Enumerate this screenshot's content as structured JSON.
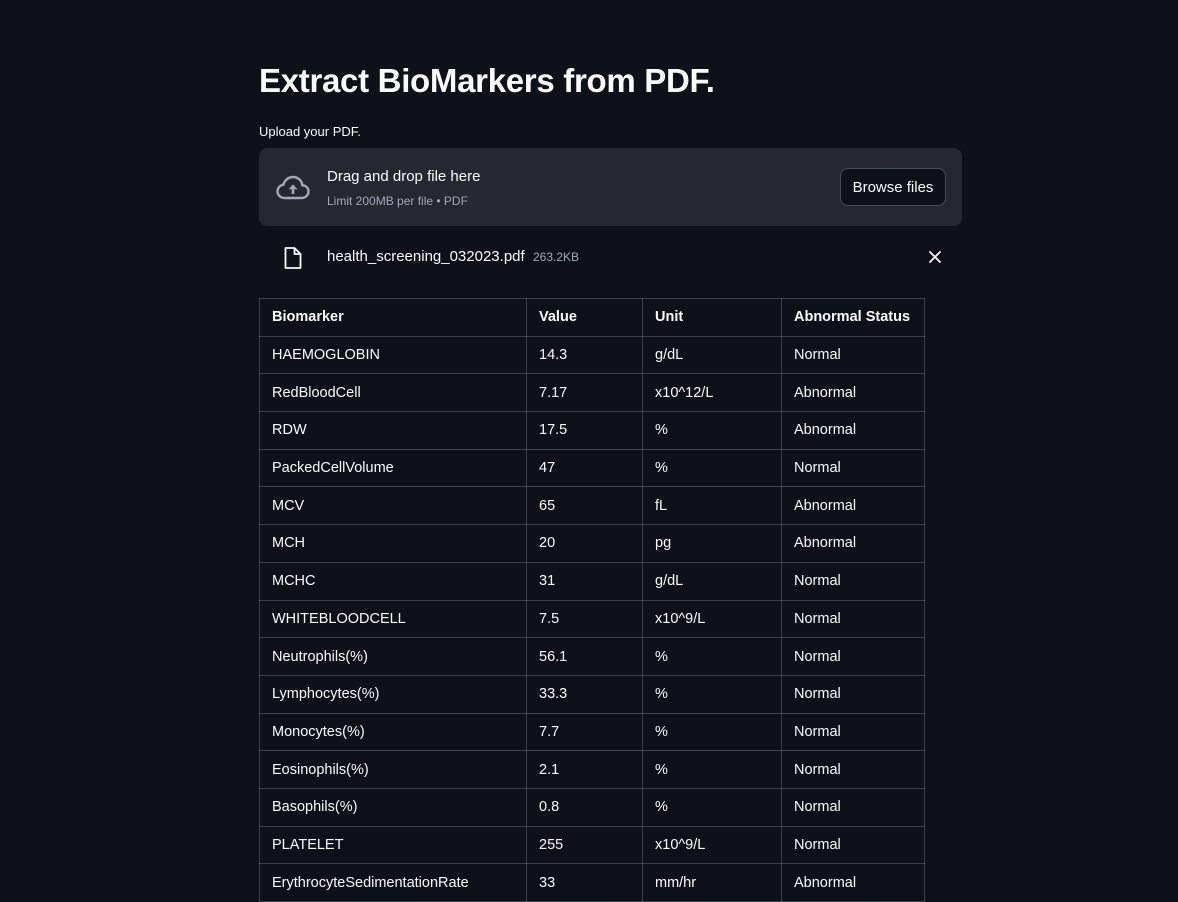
{
  "page": {
    "title": "Extract BioMarkers from PDF.",
    "upload_label": "Upload your PDF."
  },
  "uploader": {
    "drop_title": "Drag and drop file here",
    "drop_subtitle": "Limit 200MB per file • PDF",
    "browse_label": "Browse files",
    "icon": "cloud-upload-icon"
  },
  "file": {
    "name": "health_screening_032023.pdf",
    "size": "263.2KB",
    "icon": "file-icon",
    "remove_icon": "close-icon"
  },
  "table": {
    "headers": [
      "Biomarker",
      "Value",
      "Unit",
      "Abnormal Status"
    ],
    "rows": [
      [
        "HAEMOGLOBIN",
        "14.3",
        "g/dL",
        "Normal"
      ],
      [
        "RedBloodCell",
        "7.17",
        "x10^12/L",
        "Abnormal"
      ],
      [
        "RDW",
        "17.5",
        "%",
        "Abnormal"
      ],
      [
        "PackedCellVolume",
        "47",
        "%",
        "Normal"
      ],
      [
        "MCV",
        "65",
        "fL",
        "Abnormal"
      ],
      [
        "MCH",
        "20",
        "pg",
        "Abnormal"
      ],
      [
        "MCHC",
        "31",
        "g/dL",
        "Normal"
      ],
      [
        "WHITEBLOODCELL",
        "7.5",
        "x10^9/L",
        "Normal"
      ],
      [
        "Neutrophils(%)",
        "56.1",
        "%",
        "Normal"
      ],
      [
        "Lymphocytes(%)",
        "33.3",
        "%",
        "Normal"
      ],
      [
        "Monocytes(%)",
        "7.7",
        "%",
        "Normal"
      ],
      [
        "Eosinophils(%)",
        "2.1",
        "%",
        "Normal"
      ],
      [
        "Basophils(%)",
        "0.8",
        "%",
        "Normal"
      ],
      [
        "PLATELET",
        "255",
        "x10^9/L",
        "Normal"
      ],
      [
        "ErythrocyteSedimentationRate",
        "33",
        "mm/hr",
        "Abnormal"
      ]
    ]
  },
  "colors": {
    "background": "#0e1117",
    "dropzone": "#262730",
    "text": "#fafafa",
    "muted": "#a3a8b8"
  }
}
